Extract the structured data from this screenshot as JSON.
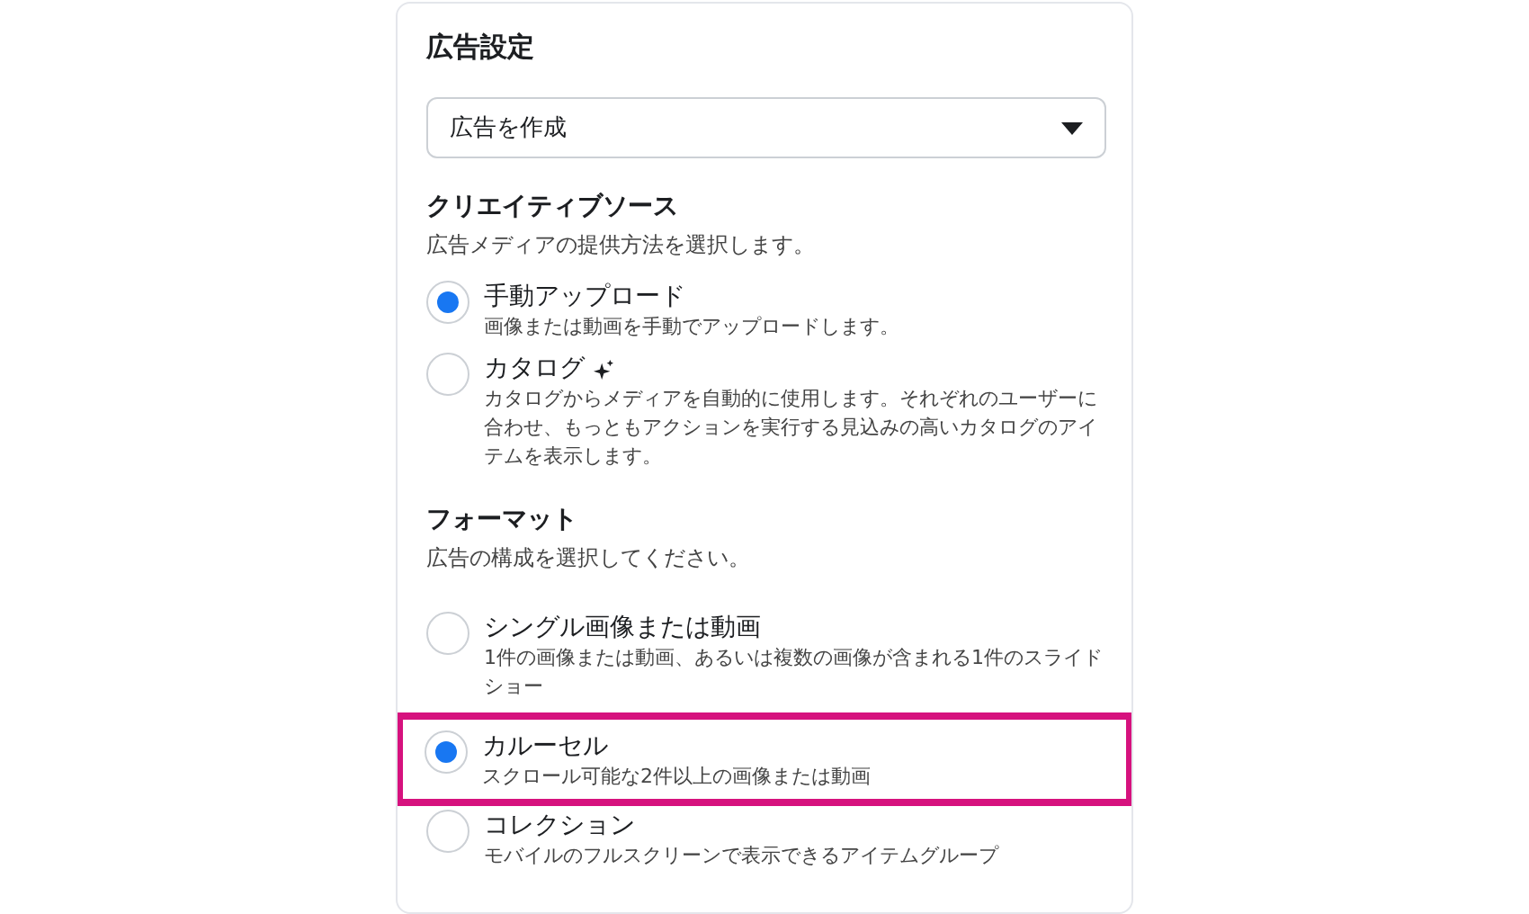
{
  "panel": {
    "title": "広告設定",
    "dropdown": {
      "value": "広告を作成"
    },
    "sections": [
      {
        "heading": "クリエイティブソース",
        "description": "広告メディアの提供方法を選択します。",
        "options": [
          {
            "label": "手動アップロード",
            "description": "画像または動画を手動でアップロードします。",
            "selected": true
          },
          {
            "label": "カタログ",
            "description": "カタログからメディアを自動的に使用します。それぞれのユーザーに合わせ、もっともアクションを実行する見込みの高いカタログのアイテムを表示します。",
            "selected": false,
            "sparkle": true
          }
        ]
      },
      {
        "heading": "フォーマット",
        "description": "広告の構成を選択してください。",
        "options": [
          {
            "label": "シングル画像または動画",
            "description": "1件の画像または動画、あるいは複数の画像が含まれる1件のスライドショー",
            "selected": false
          },
          {
            "label": "カルーセル",
            "description": "スクロール可能な2件以上の画像または動画",
            "selected": true,
            "highlighted": true
          },
          {
            "label": "コレクション",
            "description": "モバイルのフルスクリーンで表示できるアイテムグループ",
            "selected": false
          }
        ]
      }
    ]
  }
}
